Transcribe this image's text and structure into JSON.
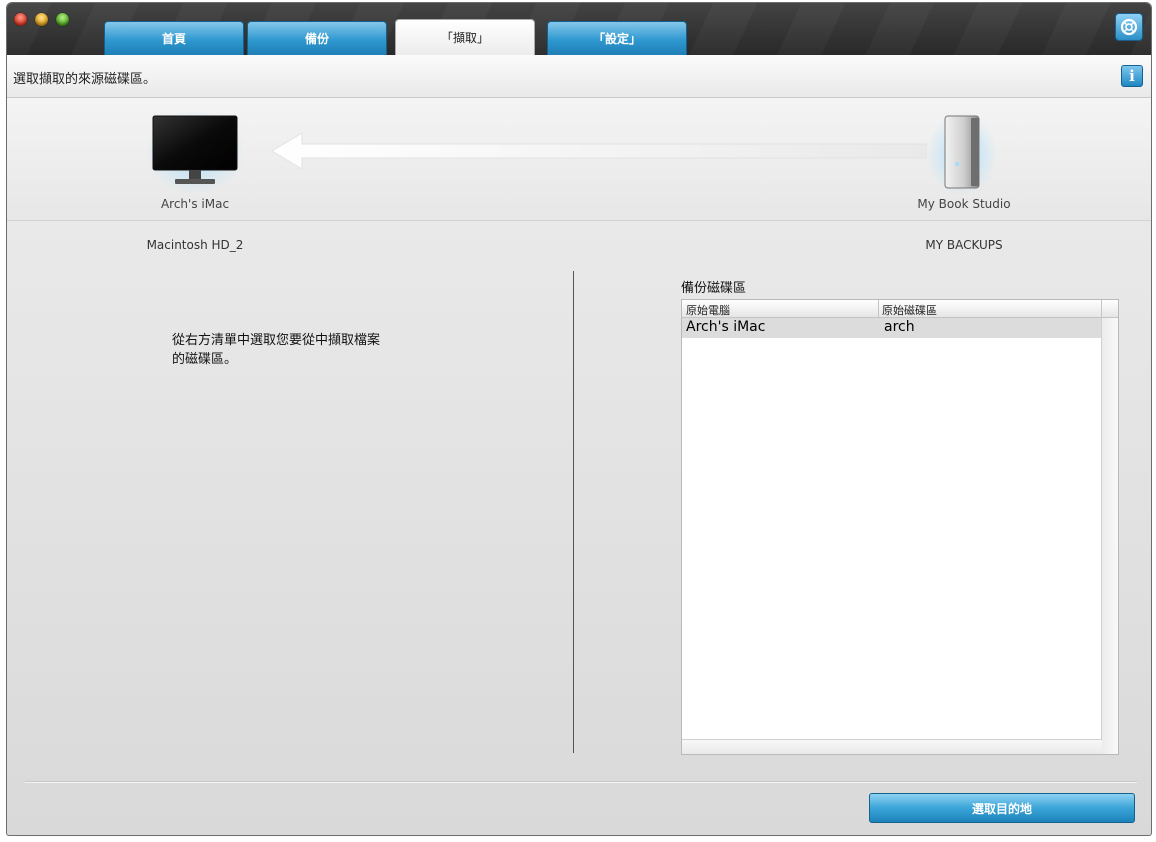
{
  "tabs": [
    {
      "label": "首頁"
    },
    {
      "label": "備份"
    },
    {
      "label": "「擷取」"
    },
    {
      "label": "「設定」"
    }
  ],
  "active_tab": "「擷取」",
  "instruction": "選取擷取的來源磁碟區。",
  "devices": {
    "source": {
      "name": "Arch's iMac",
      "volume": "Macintosh HD_2"
    },
    "target": {
      "name": "My Book Studio",
      "volume": "MY BACKUPS"
    }
  },
  "left_message": "從右方清單中選取您要從中擷取檔案\n的磁碟區。",
  "backup_list": {
    "title": "備份磁碟區",
    "columns": [
      "原始電腦",
      "原始磁碟區"
    ],
    "rows": [
      {
        "computer": "Arch's iMac",
        "volume": "arch"
      }
    ]
  },
  "next_button": "選取目的地",
  "colors": {
    "accent": "#2f98cf",
    "selected_row": "#dcdcdc"
  }
}
